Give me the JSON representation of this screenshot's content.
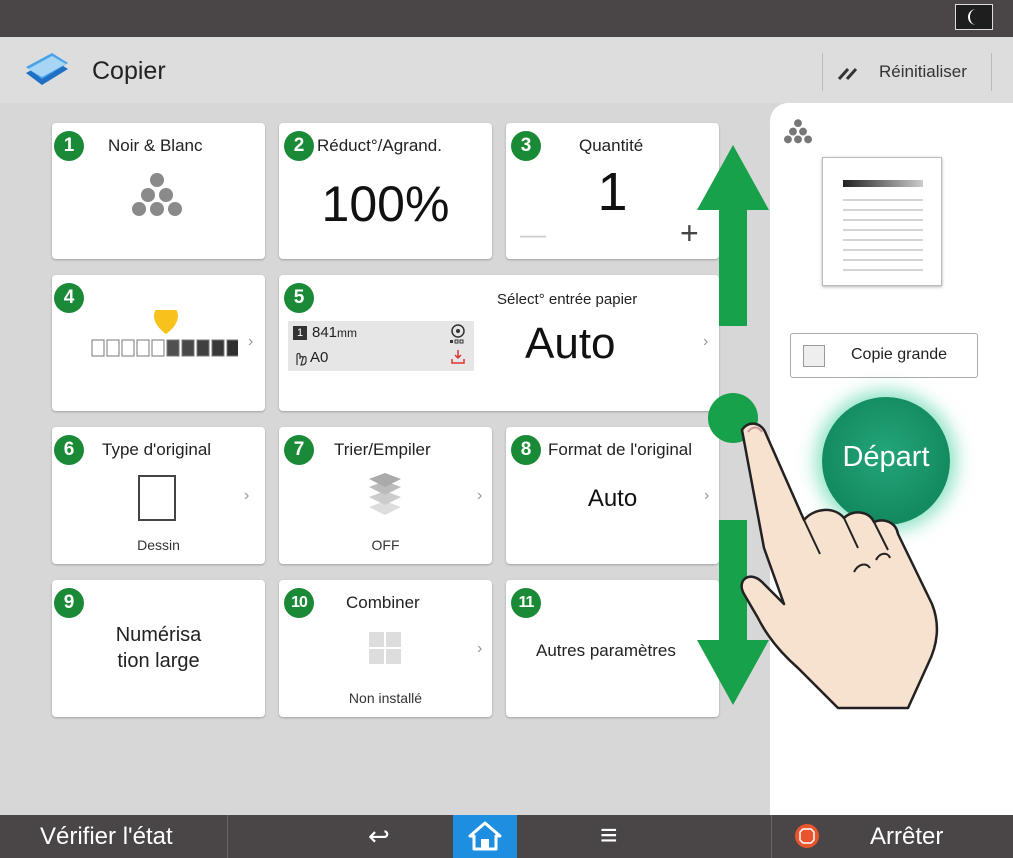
{
  "header": {
    "app_title": "Copier",
    "reset_label": "Réinitialiser"
  },
  "tiles": [
    {
      "num": "1",
      "label": "Noir & Blanc"
    },
    {
      "num": "2",
      "label": "Réduct°/Agrand.",
      "value": "100%"
    },
    {
      "num": "3",
      "label": "Quantité",
      "value": "1",
      "minus": "—",
      "plus": "+"
    },
    {
      "num": "4"
    },
    {
      "num": "5",
      "label": "Sélect° entrée papier",
      "value": "Auto",
      "roll_num": "1",
      "roll_size": "841",
      "roll_unit": "mm",
      "sheet_size": "A0"
    },
    {
      "num": "6",
      "label": "Type d'original",
      "value": "Dessin"
    },
    {
      "num": "7",
      "label": "Trier/Empiler",
      "value": "OFF"
    },
    {
      "num": "8",
      "label": "Format de l'original",
      "value": "Auto"
    },
    {
      "num": "9",
      "label_line1": "Numérisa",
      "label_line2": "tion large"
    },
    {
      "num": "10",
      "label": "Combiner",
      "value": "Non installé"
    },
    {
      "num": "11",
      "label": "Autres paramètres"
    }
  ],
  "chevron": "›",
  "density": {
    "level": 0.5,
    "segments": 10
  },
  "side": {
    "copie_grande_label": "Copie grande",
    "start_label": "Départ"
  },
  "bottom": {
    "status_label": "Vérifier l'état",
    "back_glyph": "↩",
    "menu_glyph": "≡",
    "stop_label": "Arrêter"
  },
  "colors": {
    "badge": "#1b8a36",
    "start": "#138a5f",
    "home": "#1e8fe0",
    "stop": "#e8552d",
    "gesture_arrow": "#17a14a"
  },
  "icons": [
    "moon-icon",
    "copier-app-icon",
    "reset-icon",
    "bw-toner-icon",
    "original-type-icon",
    "sort-stack-icon",
    "combine-icon",
    "back-icon",
    "home-icon",
    "menu-icon",
    "stop-icon"
  ]
}
